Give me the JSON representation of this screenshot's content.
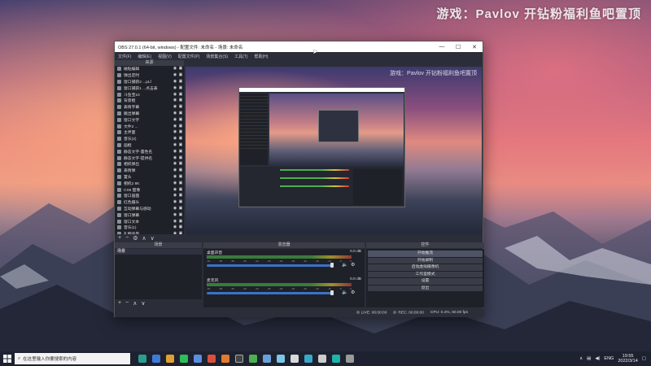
{
  "watermark": "游戏：Pavlov   开钻粉福利鱼吧置顶",
  "obs": {
    "title": "OBS 27.0.1 (64-bit, windows) - 配置文件: 未命名 - 场景: 未命名",
    "window_buttons": [
      "—",
      "☐",
      "✕"
    ],
    "menu": [
      "文件(F)",
      "编辑(E)",
      "视图(V)",
      "配置文件(P)",
      "场景集合(S)",
      "工具(T)",
      "帮助(H)"
    ],
    "sources_header": "来源",
    "sources": [
      "磁贴编辑",
      "弹出定时",
      "窗口捕获2 ...pLf",
      "窗口捕获1 ...点击表",
      "斗鱼宝10",
      "背景框",
      "表情字幕",
      "跳出弹幕",
      "窗口文字",
      "文件2 ...",
      "主界面",
      "音乐(2)",
      "画框",
      "静态文字-置性名",
      "静态文字-提供名",
      "相机弹出",
      "表情弹",
      "置头",
      "相机2 8K",
      "CS6 图像",
      "窗口画面",
      "红色摄头",
      "互动弹幕与感动",
      "窗口弹幕",
      "窗口文本",
      "音乐(1)",
      "礼物背景"
    ],
    "sources_toolbar": [
      "+",
      "−",
      "⚙",
      "∧",
      "∨"
    ],
    "preview_watermark": "游戏：Pavlov   开钻粉福利鱼吧置顶",
    "scenes_header": "场景",
    "scenes": [
      "场景"
    ],
    "scenes_toolbar": [
      "+",
      "−",
      "∧",
      "∨"
    ],
    "mixer_header": "混音器",
    "mixer": [
      {
        "name": "桌面声音",
        "db": "0.0 dB",
        "level": 0.95
      },
      {
        "name": "麦克风",
        "db": "0.0 dB",
        "level": 0.95
      }
    ],
    "mixer_ticks": [
      "-60",
      "-55",
      "-50",
      "-45",
      "-40",
      "-35",
      "-30",
      "-25",
      "-20",
      "-15",
      "-10",
      "-5",
      "0"
    ],
    "controls_header": "控件",
    "controls": [
      "开始推流",
      "开始录制",
      "启动虚拟摄像机",
      "工作室模式",
      "设置",
      "退出"
    ],
    "status": {
      "live": "LIVE: 00:00:00",
      "rec": "REC: 00:00:00",
      "cpu": "CPU: 0.4%, 60.00 fps"
    }
  },
  "taskbar": {
    "search_placeholder": "在这里输入你要搜索的内容",
    "tray_lang": "ENG",
    "time": "19:55",
    "date": "2022/3/14"
  }
}
